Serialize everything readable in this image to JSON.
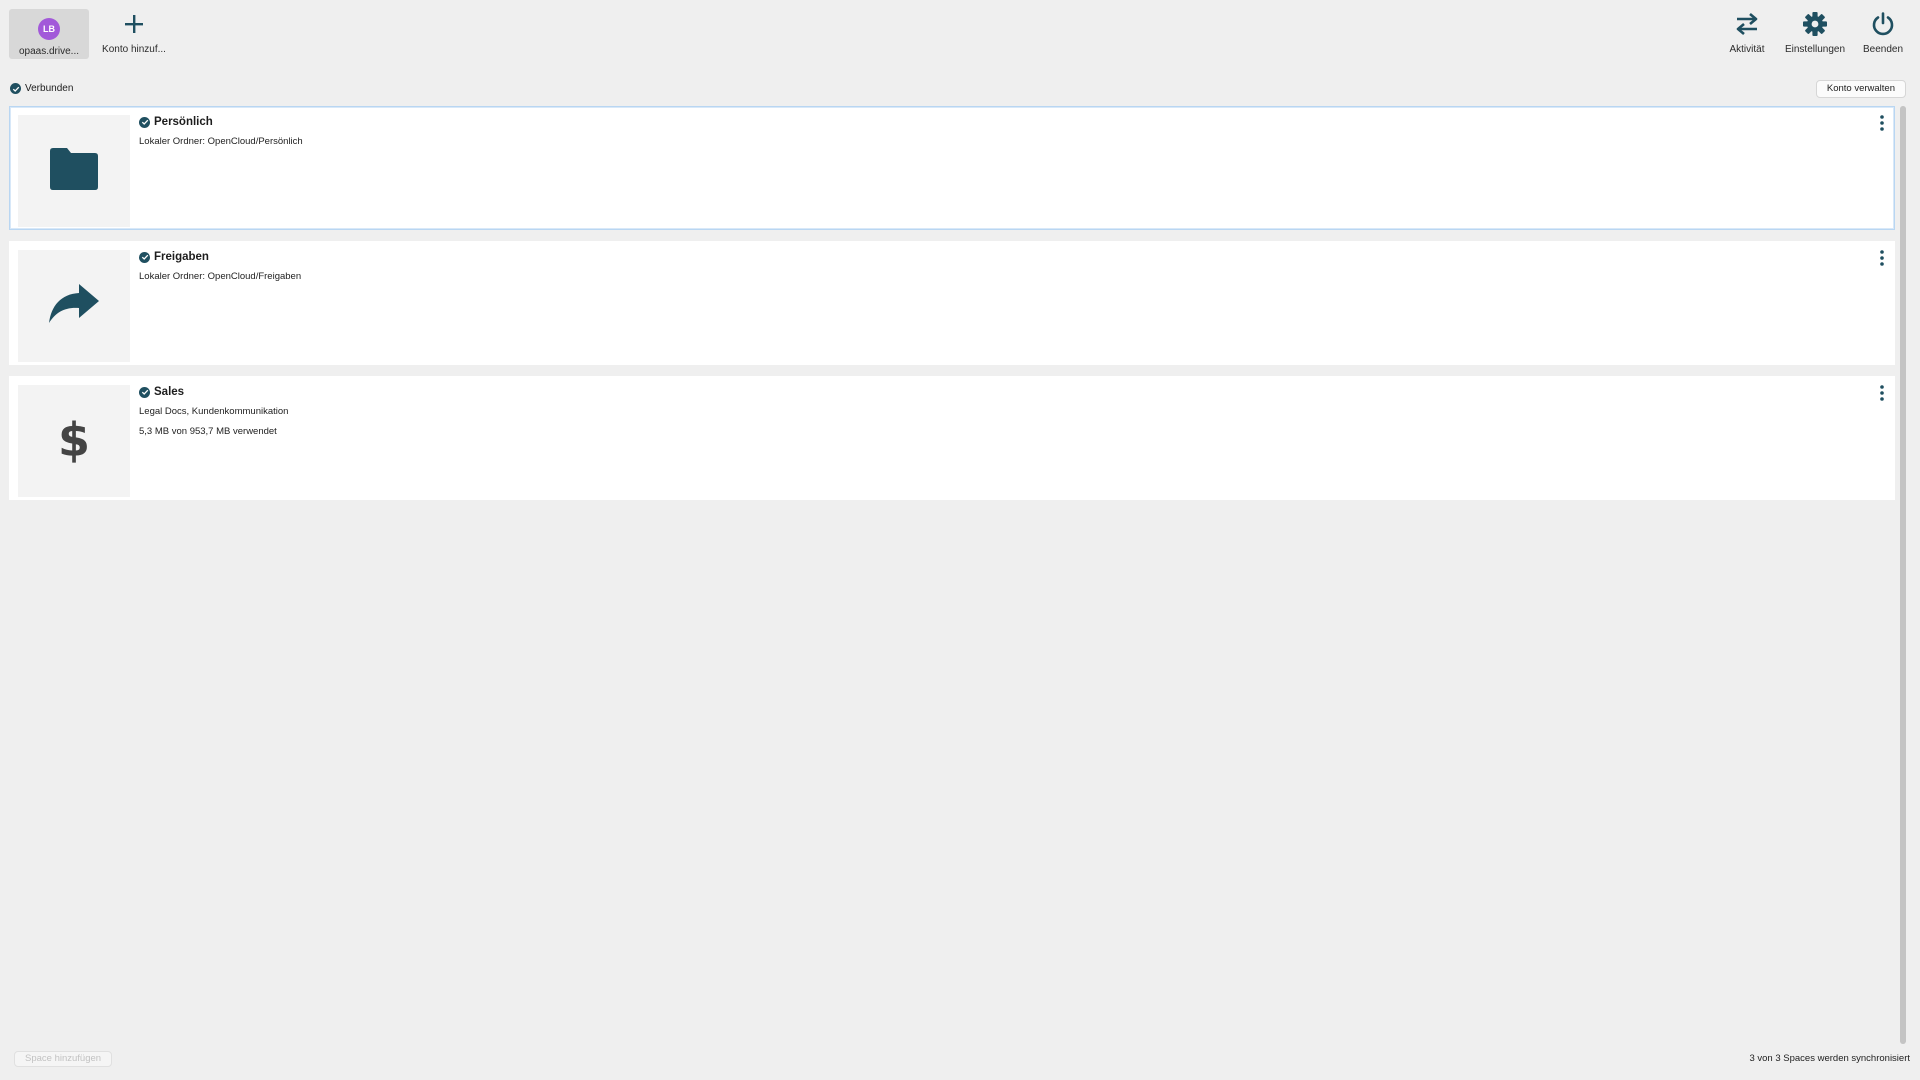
{
  "toolbar": {
    "account": {
      "initials": "LB",
      "label": "opaas.drive...",
      "avatar_color": "#a259d9"
    },
    "add_account": {
      "label": "Konto hinzuf..."
    },
    "activity": {
      "label": "Aktivität"
    },
    "settings": {
      "label": "Einstellungen"
    },
    "quit": {
      "label": "Beenden"
    }
  },
  "status": {
    "label": "Verbunden",
    "icon": "check-circle-icon"
  },
  "manage_account": {
    "label": "Konto verwalten"
  },
  "spaces": [
    {
      "title": "Persönlich",
      "icon": "folder-icon",
      "lines": [
        "Lokaler Ordner: OpenCloud/Persönlich"
      ],
      "selected": true
    },
    {
      "title": "Freigaben",
      "icon": "share-arrow-icon",
      "lines": [
        "Lokaler Ordner: OpenCloud/Freigaben"
      ],
      "selected": false
    },
    {
      "title": "Sales",
      "icon": "dollar-icon",
      "lines": [
        "Legal Docs, Kundenkommunikation",
        "5,3 MB von 953,7 MB verwendet"
      ],
      "selected": false
    }
  ],
  "footer": {
    "add_space": "Space hinzufügen",
    "sync_status": "3 von 3 Spaces werden synchronisiert"
  },
  "colors": {
    "accent": "#1f4f60",
    "background": "#efefef",
    "selection_border": "#b9d6f2"
  }
}
